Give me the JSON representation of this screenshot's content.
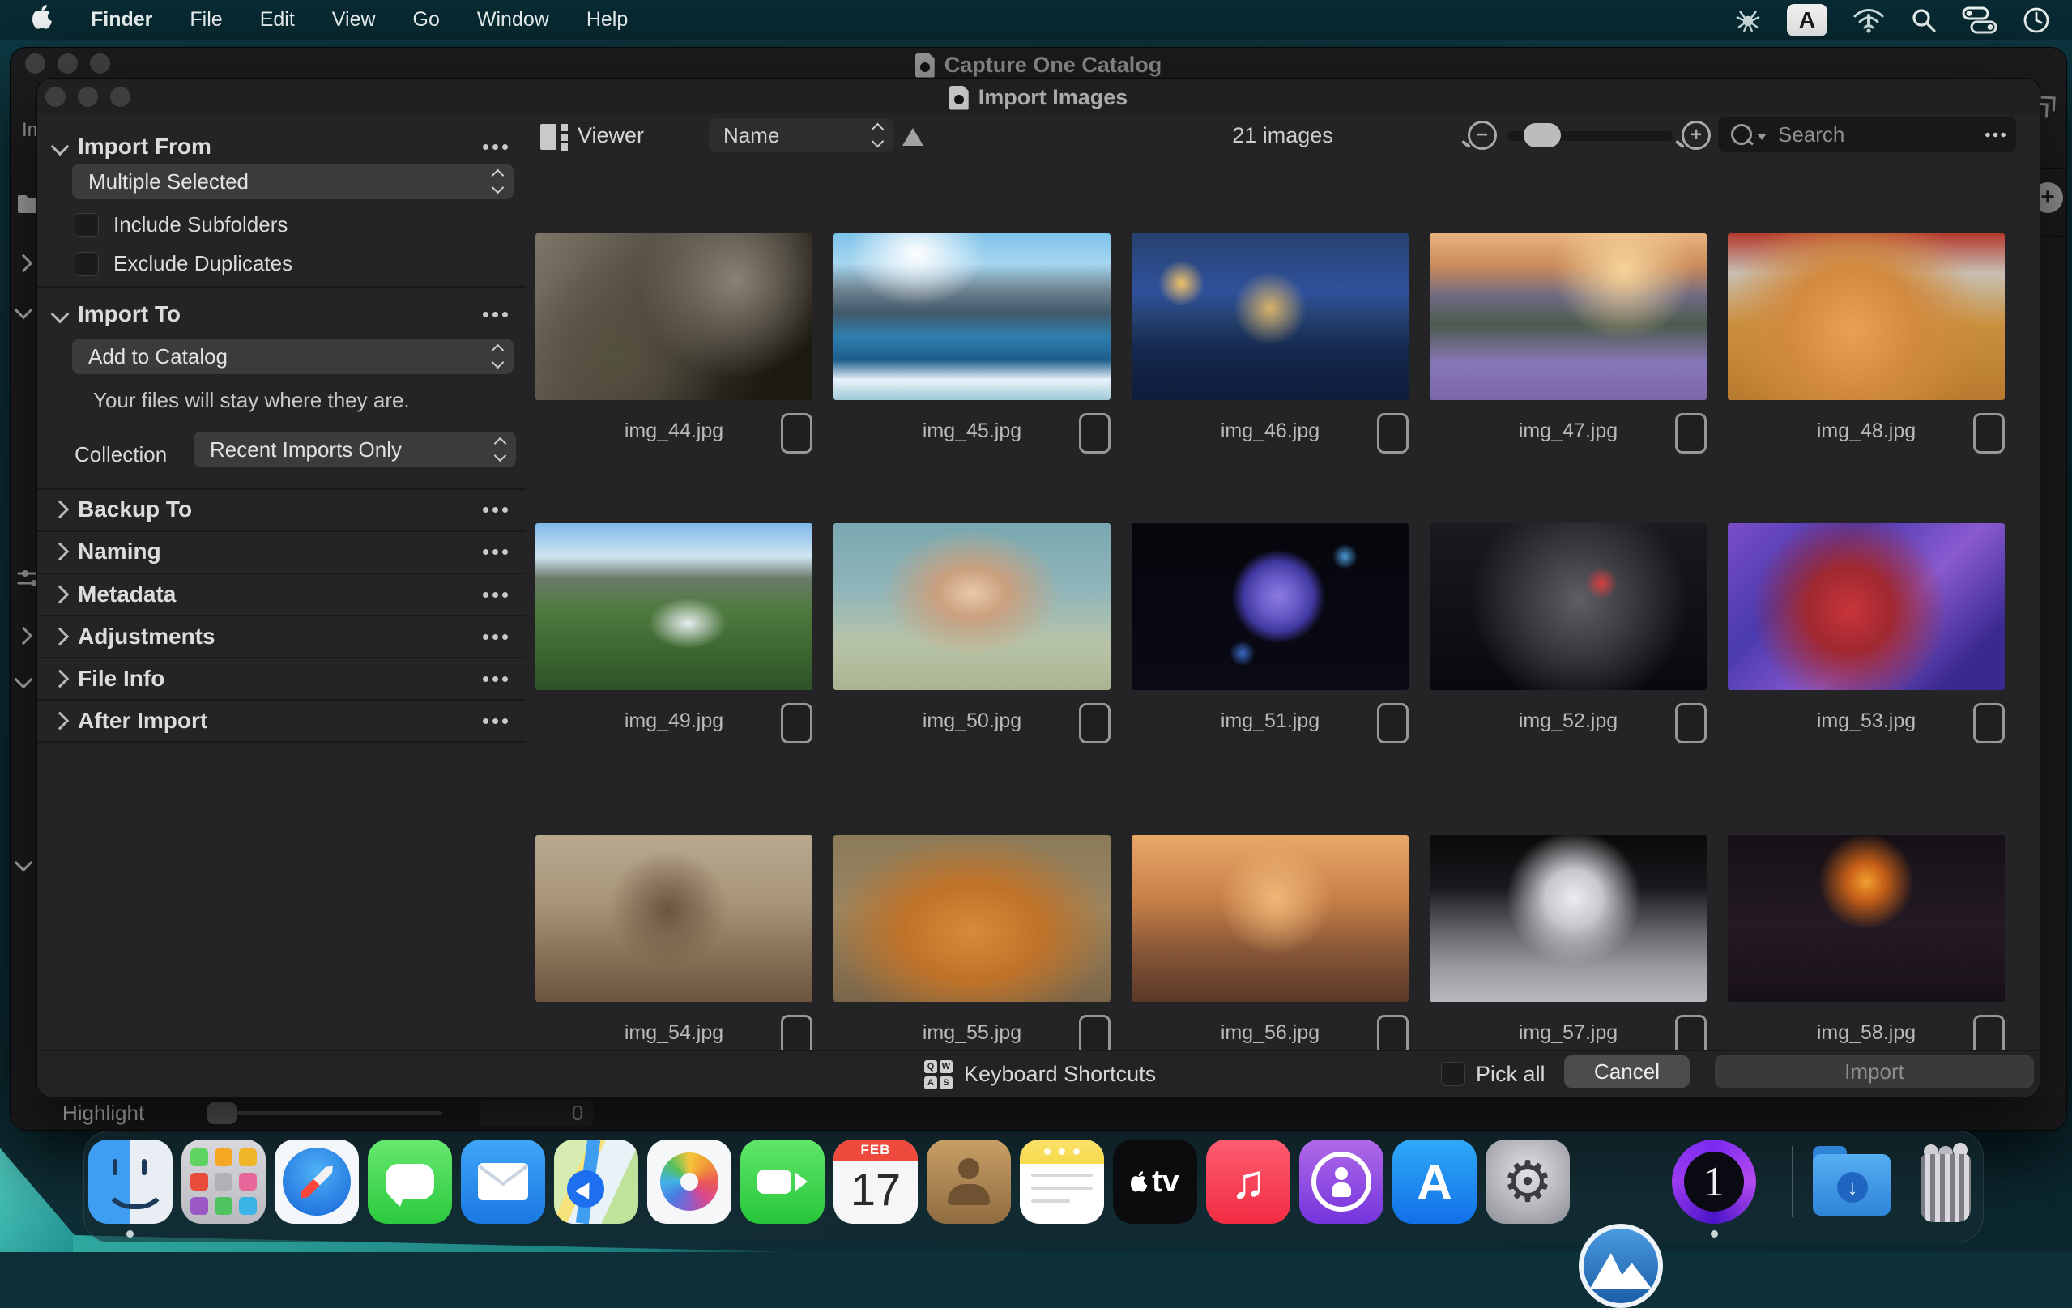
{
  "menubar": {
    "items": [
      "Finder",
      "File",
      "Edit",
      "View",
      "Go",
      "Window",
      "Help"
    ],
    "status_icons": [
      "drweb-icon",
      "input-source-a",
      "wifi-alert",
      "spotlight",
      "control-center",
      "clock"
    ],
    "input_source_label": "A"
  },
  "background_window": {
    "title": "Capture One Catalog",
    "clipped_label": "Im",
    "highlight_label": "Highlight",
    "highlight_value": "0"
  },
  "dialog": {
    "title": "Import Images",
    "sidebar": {
      "import_from": {
        "title": "Import From",
        "menu_value": "Multiple Selected",
        "checkbox1": "Include Subfolders",
        "checkbox2": "Exclude Duplicates"
      },
      "import_to": {
        "title": "Import To",
        "menu_value": "Add to Catalog",
        "note": "Your files will stay where they are.",
        "collection_label": "Collection",
        "collection_value": "Recent Imports Only"
      },
      "collapsed": [
        "Backup To",
        "Naming",
        "Metadata",
        "Adjustments",
        "File Info",
        "After Import"
      ]
    },
    "toolbar": {
      "viewer_label": "Viewer",
      "sort_value": "Name",
      "count": "21 images",
      "search_placeholder": "Search"
    },
    "grid": {
      "images": [
        {
          "name": "img_44.jpg",
          "art": "background:radial-gradient(circle at 72% 28%, #8a8274 0%, rgba(0,0,0,0) 42%),radial-gradient(circle at 30% 75%, #55503f 0%, rgba(0,0,0,0) 45%),linear-gradient(120deg,#7d7668 0%,#4a443a 45%,#1c1913 85%)"
        },
        {
          "name": "img_45.jpg",
          "art": "background:radial-gradient(ellipse at 30% 12%, #ffffff 0%, rgba(255,255,255,0) 25%),linear-gradient(180deg,#7ec3ea 0%,#a5d6f0 18%,#6f8390 34%,#41596b 48%,#2e7fae 62%,#1d5d8c 76%,#e8f4fa 88%,#9fc8d8 100%)"
        },
        {
          "name": "img_46.jpg",
          "art": "background:radial-gradient(circle at 18% 30%, #f2c268 0%, rgba(0,0,0,0) 9%),radial-gradient(circle at 50% 45%, #d8b36a 0%, rgba(0,0,0,0) 22%),linear-gradient(180deg,#27426e 0%,#30519c 35%,#24406e 52%,#15284e 70%,#0e1c3a 100%)"
        },
        {
          "name": "img_47.jpg",
          "art": "background:radial-gradient(circle at 70% 22%, #f6d49a 0%, rgba(0,0,0,0) 30%),linear-gradient(180deg,#e8b47e 0%,#c98a5c 20%,#6d6a82 38%,#4c5b4e 55%,#8877b8 78%,#7a66aa 100%)"
        },
        {
          "name": "img_48.jpg",
          "art": "background:radial-gradient(circle at 45% 58%, #e8a155 0%, #d18a3e 35%, rgba(0,0,0,0) 72%),linear-gradient(180deg,#b33a2e 0%,#c8c0b4 24%,#c9903f 55%,#b87a2e 100%)"
        },
        {
          "name": "img_49.jpg",
          "art": "background:radial-gradient(ellipse at 55% 60%, #e8eef0 0%, rgba(255,255,255,0) 18%),linear-gradient(180deg,#7fb8e8 0%,#cfe5f2 20%,#6b7b6a 33%,#4f7a3f 52%,#3f6b33 72%,#2f5227 100%)"
        },
        {
          "name": "img_50.jpg",
          "art": "background:radial-gradient(ellipse at 50% 42%, #e8c9a8 0%, #caa07e 18%, rgba(0,0,0,0) 46%),linear-gradient(180deg,#7aa8b0 0%,#8fb5ba 40%,#b8c4a8 72%,#a8b490 100%)"
        },
        {
          "name": "img_51.jpg",
          "art": "background:radial-gradient(circle at 53% 44%, #8a7ce0 0%, #6a5cc8 11%, #4038a0 20%, rgba(0,0,0,0) 27%),radial-gradient(circle at 77% 20%, #4a9ad8 0%, rgba(0,0,0,0) 5%),radial-gradient(circle at 40% 78%, #3a6ac8 0%, rgba(0,0,0,0) 6%),linear-gradient(180deg,#06060c,#0a0a16)"
        },
        {
          "name": "img_52.jpg",
          "art": "background:radial-gradient(circle at 62% 36%, #d84040 0%, rgba(0,0,0,0) 8%),radial-gradient(circle at 54% 46%, #5e5e64 0%, #3a3a40 30%, rgba(0,0,0,0) 62%),linear-gradient(180deg,#1a1a1e,#0a0a0e)"
        },
        {
          "name": "img_53.jpg",
          "art": "background:radial-gradient(circle at 44% 52%, #c8353a 0%, #a02830 24%, rgba(0,0,0,0) 55%),linear-gradient(135deg,#7a4ec8 0%,#4a3ab0 30%,#8a5ad0 58%,#3a2a90 85%)"
        },
        {
          "name": "img_54.jpg",
          "art": "background:radial-gradient(circle at 48% 45%, #6a5440 0%, rgba(0,0,0,0) 35%),linear-gradient(180deg,#b8a890 0%,#a89578 40%,#8a7458 70%,#6a5440 100%)"
        },
        {
          "name": "img_55.jpg",
          "art": "background:radial-gradient(ellipse at 50% 58%, #d88a3a 0%, #c07328 35%, rgba(0,0,0,0) 72%),linear-gradient(180deg,#8a7a5a 0%,#9a8560 45%,#7a6548 100%)"
        },
        {
          "name": "img_56.jpg",
          "art": "background:radial-gradient(circle at 52% 38%, #f0b878 0%, rgba(0,0,0,0) 32%),linear-gradient(180deg,#e8a868 0%,#c88048 38%,#8a5838 68%,#5a3828 100%)"
        },
        {
          "name": "img_57.jpg",
          "art": "background:radial-gradient(circle at 52% 38%, #ececf0 0%, #c8c8cc 16%, rgba(0,0,0,0) 38%),linear-gradient(180deg,#0a0a0c 0%,#1a1a1e 32%,#6a6a70 60%,#9a9aa0 80%,#b8b8bc 100%)"
        },
        {
          "name": "img_58.jpg",
          "art": "background:radial-gradient(circle at 50% 28%, #f0a030 0%, #c86018 10%, rgba(0,0,0,0) 26%),linear-gradient(180deg,#161016,#241a24 55%,#181018)"
        }
      ]
    },
    "footer": {
      "shortcuts_label": "Keyboard Shortcuts",
      "keys": [
        "Q",
        "W",
        "A",
        "S"
      ],
      "pick_all_label": "Pick all",
      "cancel_label": "Cancel",
      "import_label": "Import"
    }
  },
  "dock": {
    "apps": [
      "Finder",
      "Launchpad",
      "Safari",
      "Messages",
      "Mail",
      "Maps",
      "Photos",
      "FaceTime",
      "Calendar",
      "Contacts",
      "Notes",
      "TV",
      "Music",
      "Podcasts",
      "App Store",
      "System Settings",
      "Capture One Mountains",
      "Capture One",
      "Downloads",
      "Trash"
    ],
    "calendar_month": "FEB",
    "calendar_day": "17",
    "tv_label": "tv",
    "music_glyph": "♫",
    "appstore_glyph": "A",
    "settings_glyph": "⚙",
    "captureone_glyph": "1",
    "download_glyph": "↓"
  }
}
